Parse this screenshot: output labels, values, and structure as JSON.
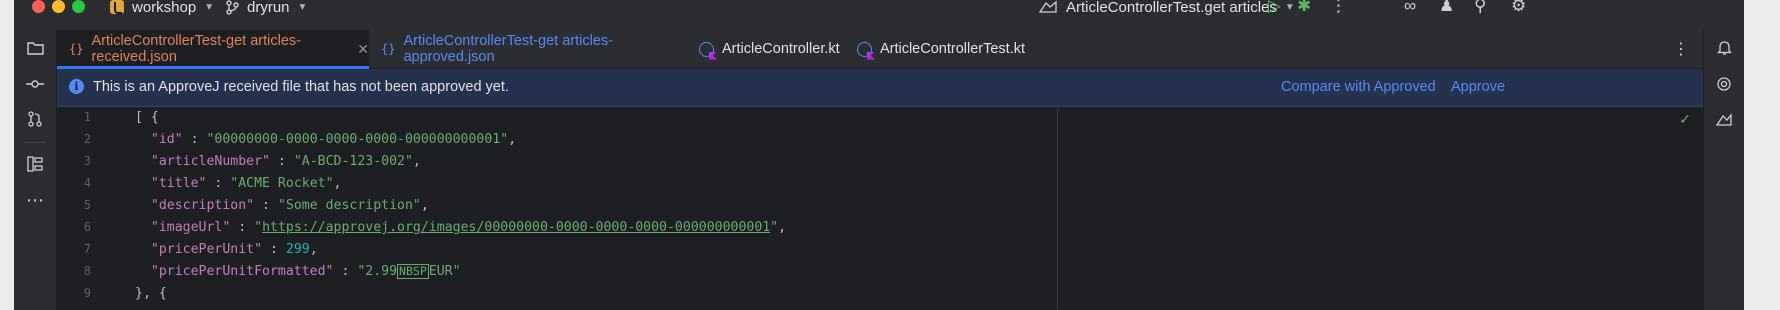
{
  "titlebar": {
    "project": "workshop",
    "branch": "dryrun",
    "run_config": "ArticleControllerTest.get articles"
  },
  "tabs": [
    {
      "label": "ArticleControllerTest-get articles-received.json",
      "icon": "json-braces-icon",
      "color": "#e0825b",
      "active": true
    },
    {
      "label": "ArticleControllerTest-get articles-approved.json",
      "icon": "json-braces-icon",
      "color": "#548af7",
      "active": false
    },
    {
      "label": "ArticleController.kt",
      "icon": "kotlin-class-icon",
      "color": "#dfe1e5",
      "active": false
    },
    {
      "label": "ArticleControllerTest.kt",
      "icon": "kotlin-class-icon",
      "color": "#dfe1e5",
      "active": false
    }
  ],
  "banner": {
    "message": "This is an ApproveJ received file that has not been approved yet.",
    "compare_label": "Compare with Approved",
    "approve_label": "Approve"
  },
  "editor": {
    "line_numbers": [
      "1",
      "2",
      "3",
      "4",
      "5",
      "6",
      "7",
      "8",
      "9"
    ],
    "code": {
      "l1": "[ {",
      "l2_key": "\"id\"",
      "l2_val": "\"00000000-0000-0000-0000-000000000001\"",
      "l3_key": "\"articleNumber\"",
      "l3_val": "\"A-BCD-123-002\"",
      "l4_key": "\"title\"",
      "l4_val": "\"ACME Rocket\"",
      "l5_key": "\"description\"",
      "l5_val": "\"Some description\"",
      "l6_key": "\"imageUrl\"",
      "l6_q": "\"",
      "l6_url": "https://approvej.org/images/00000000-0000-0000-0000-000000000001",
      "l7_key": "\"pricePerUnit\"",
      "l7_val": "299",
      "l8_key": "\"pricePerUnitFormatted\"",
      "l8_val_a": "\"2.99",
      "l8_nbsp": "NBSP",
      "l8_val_b": "EUR\"",
      "l9": "}, {"
    }
  }
}
